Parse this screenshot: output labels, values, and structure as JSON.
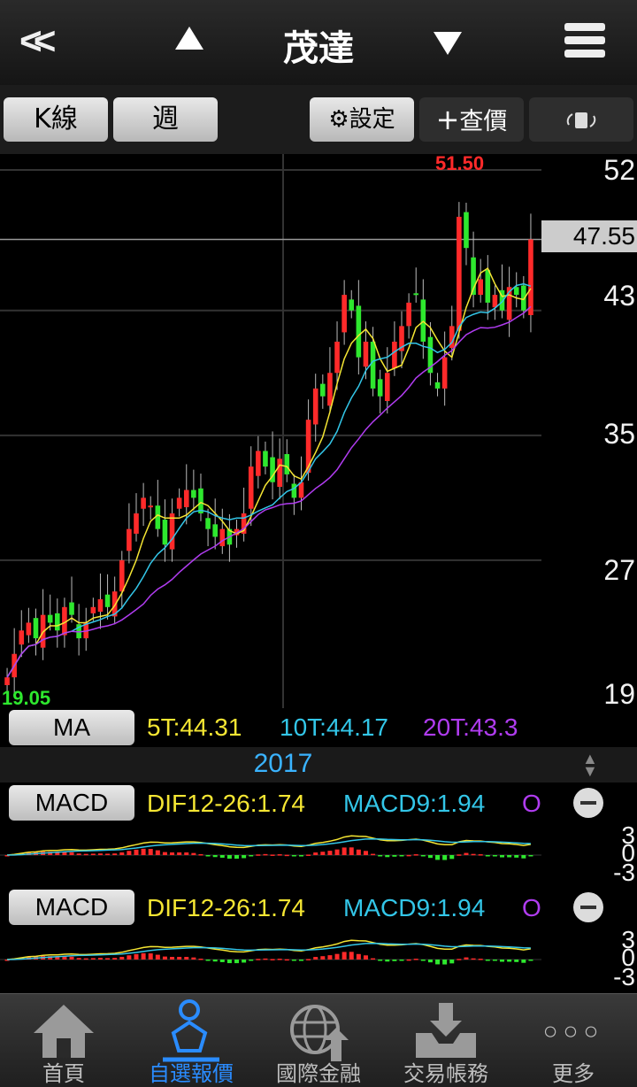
{
  "header": {
    "title": "茂達",
    "back_icon": "double-chevron-left-icon"
  },
  "toolbar": {
    "kline": "K線",
    "period": "週",
    "settings": "設定",
    "quote": "查價",
    "rotate_icon": "rotate-icon"
  },
  "price_axis": {
    "ticks": [
      "52",
      "43",
      "35",
      "27",
      "19"
    ],
    "current": "47.55",
    "high_label": "51.50",
    "low_label": "19.05"
  },
  "ma": {
    "button": "MA",
    "ma5": "5T:44.31",
    "ma10": "10T:44.17",
    "ma20": "20T:43.3"
  },
  "timeline": {
    "year": "2017"
  },
  "macd1": {
    "button": "MACD",
    "dif": "DIF12-26:1.74",
    "macd": "MACD9:1.94",
    "osc": "O",
    "ticks": [
      "3",
      "0",
      "-3"
    ]
  },
  "macd2": {
    "button": "MACD",
    "dif": "DIF12-26:1.74",
    "macd": "MACD9:1.94",
    "osc": "O",
    "ticks": [
      "3",
      "0",
      "-3"
    ]
  },
  "nav": {
    "home": "首頁",
    "watchlist": "自選報價",
    "intl": "國際金融",
    "trade": "交易帳務",
    "more": "更多"
  },
  "colors": {
    "up": "#ff2a2a",
    "down": "#2ee82e",
    "ma5": "#f5e633",
    "ma10": "#33c6e8",
    "ma20": "#b03cf0",
    "accent": "#2a8cff"
  },
  "chart_data": {
    "type": "candlestick",
    "period": "weekly",
    "y_range": [
      19,
      52
    ],
    "closes": [
      19.5,
      21,
      22.5,
      23,
      22,
      23.5,
      23,
      22.5,
      24,
      23.5,
      22,
      23,
      24,
      24.5,
      24,
      25,
      27,
      29,
      30,
      31,
      30.5,
      29,
      28,
      30,
      31,
      31.5,
      31,
      30,
      29,
      28.5,
      29,
      28,
      29,
      30,
      33,
      34,
      33,
      32,
      33.5,
      32.5,
      31,
      32,
      36,
      38,
      37.5,
      39,
      41,
      44,
      43,
      40,
      41,
      38,
      37.5,
      39,
      41,
      42,
      43.5,
      44,
      41,
      39,
      38,
      40,
      42,
      49,
      47,
      44,
      45,
      43.5,
      44,
      43,
      44.5,
      44,
      43,
      47.55
    ]
  }
}
